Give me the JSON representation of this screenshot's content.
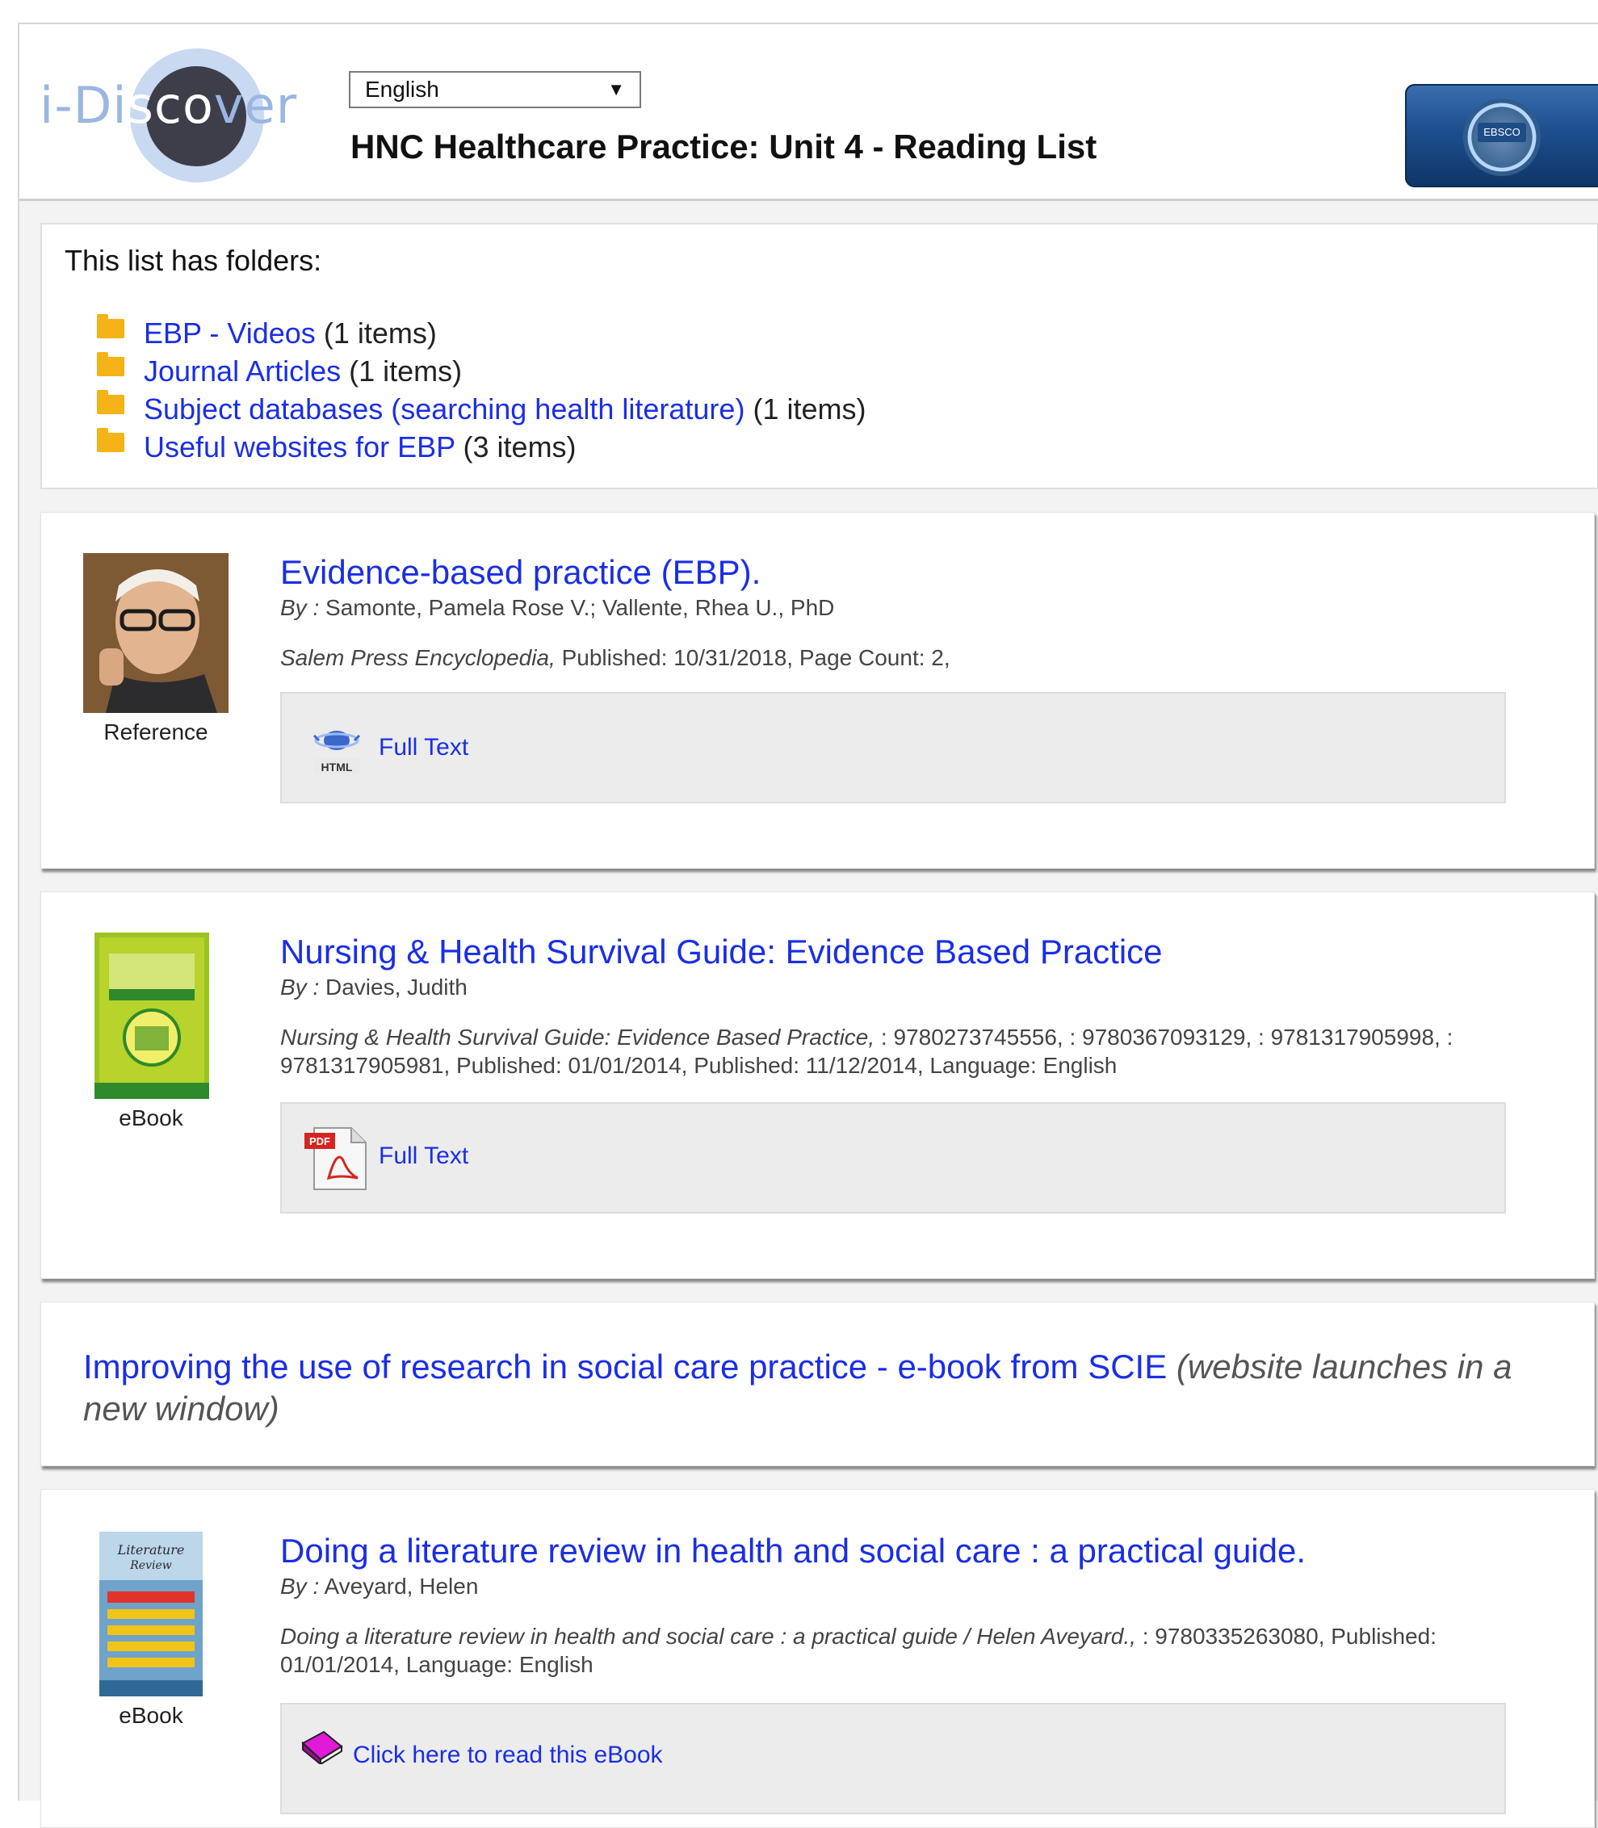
{
  "header": {
    "logo_text_a": "i-Di",
    "logo_text_b": "sco",
    "logo_text_c": "ver",
    "language": "English",
    "title": "HNC Healthcare Practice: Unit 4 - Reading List",
    "ebsco_badge_text": "EBSCO"
  },
  "folders": {
    "heading": "This list has folders:",
    "items": [
      {
        "label": "EBP - Videos",
        "count": "(1 items)"
      },
      {
        "label": "Journal Articles",
        "count": "(1 items)"
      },
      {
        "label": "Subject databases (searching health literature)",
        "count": "(1 items)"
      },
      {
        "label": "Useful websites for EBP",
        "count": "(3 items)"
      }
    ]
  },
  "items": [
    {
      "type_label": "Reference",
      "title": "Evidence-based practice (EBP).",
      "by_prefix": "By :",
      "authors": "Samonte, Pamela Rose V.; Vallente, Rhea U., PhD",
      "meta_source": "Salem Press Encyclopedia,",
      "meta_rest": " Published: 10/31/2018, Page Count: 2,",
      "link_label": "Full Text",
      "link_icon": "html-icon"
    },
    {
      "type_label": "eBook",
      "title": "Nursing & Health Survival Guide: Evidence Based Practice",
      "by_prefix": "By :",
      "authors": "Davies, Judith",
      "meta_source": "Nursing & Health Survival Guide: Evidence Based Practice,",
      "meta_rest": " : 9780273745556, : 9780367093129, : 9781317905998, : 9781317905981, Published: 01/01/2014, Published: 11/12/2014, Language: English",
      "link_label": "Full Text",
      "link_icon": "pdf-icon"
    },
    {
      "title": "Improving the use of research in social care practice - e-book from SCIE",
      "note": "(website launches in a new window)"
    },
    {
      "type_label": "eBook",
      "title": "Doing a literature review in health and social care : a practical guide.",
      "by_prefix": "By :",
      "authors": "Aveyard, Helen",
      "meta_source": "Doing a literature review in health and social care : a practical guide / Helen Aveyard.,",
      "meta_rest": " : 9780335263080, Published: 01/01/2014, Language: English",
      "link_label": "Click here to read this eBook",
      "link_icon": "book-icon"
    }
  ],
  "colors": {
    "link": "#1a2ee6",
    "folder": "#f4b316",
    "panel_gray": "#ececec"
  }
}
